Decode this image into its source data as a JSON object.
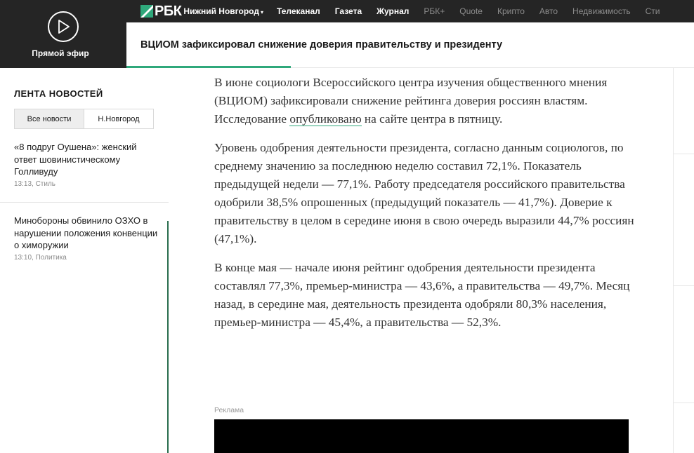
{
  "live": {
    "label": "Прямой эфир",
    "icon": "play-icon"
  },
  "topbar": {
    "logo": "РБК",
    "region": "Нижний Новгород",
    "nav": [
      {
        "label": "Телеканал",
        "bold": true
      },
      {
        "label": "Газета",
        "bold": true
      },
      {
        "label": "Журнал",
        "bold": true
      },
      {
        "label": "РБК+",
        "bold": false
      },
      {
        "label": "Quote",
        "bold": false
      },
      {
        "label": "Крипто",
        "bold": false
      },
      {
        "label": "Авто",
        "bold": false
      },
      {
        "label": "Недвижимость",
        "bold": false
      },
      {
        "label": "Сти",
        "bold": false
      }
    ]
  },
  "headline": {
    "text": "ВЦИОМ зафиксировал снижение доверия правительству и президенту",
    "progress": 0.29
  },
  "feed": {
    "title": "ЛЕНТА НОВОСТЕЙ",
    "tabs": [
      "Все новости",
      "Н.Новгород"
    ],
    "items": [
      {
        "title": "«8 подруг Оушена»: женский ответ шовинистическому Голливуду",
        "meta": "13:13, Стиль"
      },
      {
        "title": "Минобороны обвинило ОЗХО в нарушении положения конвенции о химоружии",
        "meta": "13:10, Политика"
      }
    ]
  },
  "article": {
    "p1_before": "В июне социологи Всероссийского центра изучения общественного мнения (ВЦИОМ) зафиксировали снижение рейтинга доверия россиян властям. Исследование ",
    "p1_link": "опубликовано",
    "p1_after": " на сайте центра в пятницу.",
    "p2": "Уровень одобрения деятельности президента, согласно данным социологов, по среднему значению за последнюю неделю составил 72,1%. Показатель предыдущей недели — 77,1%. Работу председателя российского правительства одобрили 38,5% опрошенных (предыдущий показатель — 41,7%). Доверие к правительству в целом в середине июня в свою очередь выразили 44,7% россиян (47,1%).",
    "p3": "В конце мая — начале июня рейтинг одобрения деятельности президента составлял 77,3%, премьер-министра — 43,6%, а правительства — 49,7%. Месяц назад, в середине мая, деятельность президента одобряли 80,3% населения, премьер-министра — 45,4%, а правительства — 52,3%."
  },
  "ad": {
    "label": "Реклама"
  },
  "colors": {
    "dark": "#252525",
    "accent": "#2fa87b",
    "text": "#333333"
  }
}
